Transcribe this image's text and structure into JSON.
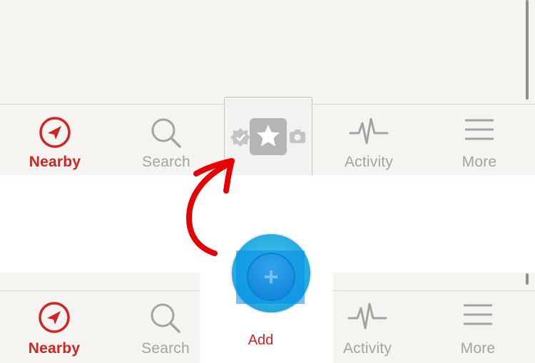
{
  "top_bar": {
    "tabs": [
      {
        "label": "Nearby",
        "icon": "nearby-arrow-icon",
        "active": true
      },
      {
        "label": "Search",
        "icon": "search-icon",
        "active": false
      },
      {
        "label": "",
        "icon": "check-in-star-camera-icon",
        "active": false
      },
      {
        "label": "Activity",
        "icon": "activity-pulse-icon",
        "active": false
      },
      {
        "label": "More",
        "icon": "menu-lines-icon",
        "active": false
      }
    ]
  },
  "bottom_bar": {
    "tabs": [
      {
        "label": "Nearby",
        "icon": "nearby-arrow-icon",
        "active": true
      },
      {
        "label": "Search",
        "icon": "search-icon",
        "active": false
      },
      {
        "label": "Add",
        "icon": "plus-icon",
        "active": false
      },
      {
        "label": "Activity",
        "icon": "activity-pulse-icon",
        "active": false
      },
      {
        "label": "More",
        "icon": "menu-lines-icon",
        "active": false
      }
    ]
  },
  "colors": {
    "accent": "#d32323",
    "inactive": "#a3a3a3",
    "bar_bg": "#f5f4f0",
    "fab_blue": "#2a9fe0",
    "annotation": "#e60000"
  }
}
